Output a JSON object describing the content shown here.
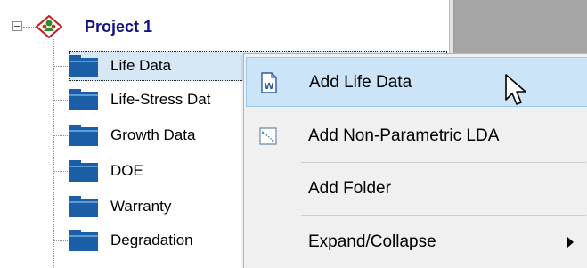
{
  "tree": {
    "project": {
      "label": "Project 1",
      "expander_glyph": "−",
      "icon": "project-icon"
    },
    "items": [
      {
        "label": "Life Data",
        "icon": "folder-icon",
        "selected": true
      },
      {
        "label": "Life-Stress Dat",
        "icon": "folder-icon",
        "selected": false
      },
      {
        "label": "Growth Data",
        "icon": "folder-icon",
        "selected": false
      },
      {
        "label": "DOE",
        "icon": "folder-icon",
        "selected": false
      },
      {
        "label": "Warranty",
        "icon": "folder-icon",
        "selected": false
      },
      {
        "label": "Degradation",
        "icon": "folder-icon",
        "selected": false
      }
    ]
  },
  "context_menu": {
    "items": [
      {
        "label": "Add Life Data",
        "icon": "word-document-icon",
        "highlighted": true
      },
      {
        "label": "Add Non-Parametric LDA",
        "icon": "chart-document-icon",
        "highlighted": false
      },
      {
        "label": "Add Folder",
        "icon": "",
        "highlighted": false
      },
      {
        "label": "Expand/Collapse",
        "icon": "",
        "highlighted": false,
        "has_submenu": true
      }
    ]
  },
  "colors": {
    "project_label": "#121282",
    "folder": "#1a5ea6",
    "menu_highlight": "#cce4f7",
    "menu_background": "#f0f0f0"
  }
}
